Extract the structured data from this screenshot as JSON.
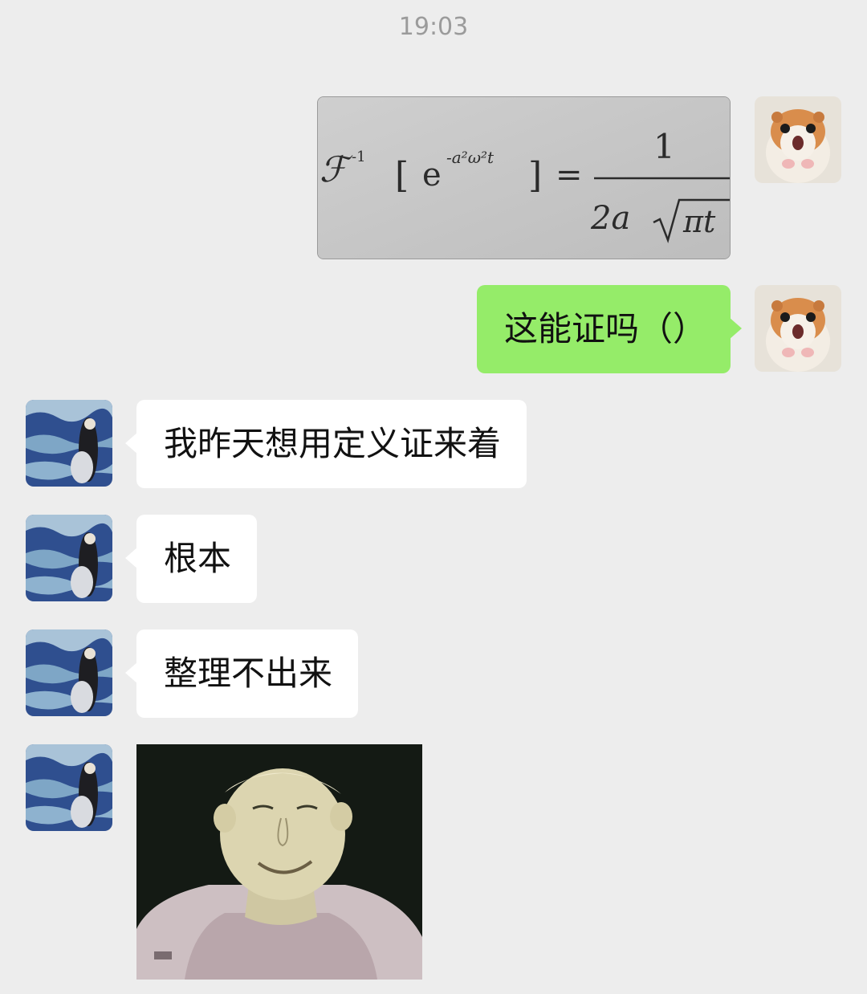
{
  "chat": {
    "timestamp": "19:03",
    "messages": [
      {
        "sender": "me",
        "type": "image",
        "image_content": "formula photo",
        "formula": {
          "operator": "ℱ",
          "exponent_inverse": "-1",
          "lbracket": "[",
          "base": "e",
          "exponent": "-a²ω²t",
          "rbracket": "]",
          "equals": "=",
          "numerator": "1",
          "denominator_left": "2a",
          "denominator_root": "πt"
        }
      },
      {
        "sender": "me",
        "type": "text",
        "text": "这能证吗（）"
      },
      {
        "sender": "them",
        "type": "text",
        "text": "我昨天想用定义证来着"
      },
      {
        "sender": "them",
        "type": "text",
        "text": "根本"
      },
      {
        "sender": "them",
        "type": "text",
        "text": "整理不出来"
      },
      {
        "sender": "them",
        "type": "image",
        "image_content": "meme sticker"
      }
    ]
  },
  "colors": {
    "background": "#ededed",
    "my_bubble": "#95ec69",
    "their_bubble": "#ffffff",
    "timestamp_text": "#9b9b9b"
  },
  "icons": {
    "my_avatar": "hamster-avatar-icon",
    "their_avatar": "blue-fish-painting-avatar-icon"
  }
}
